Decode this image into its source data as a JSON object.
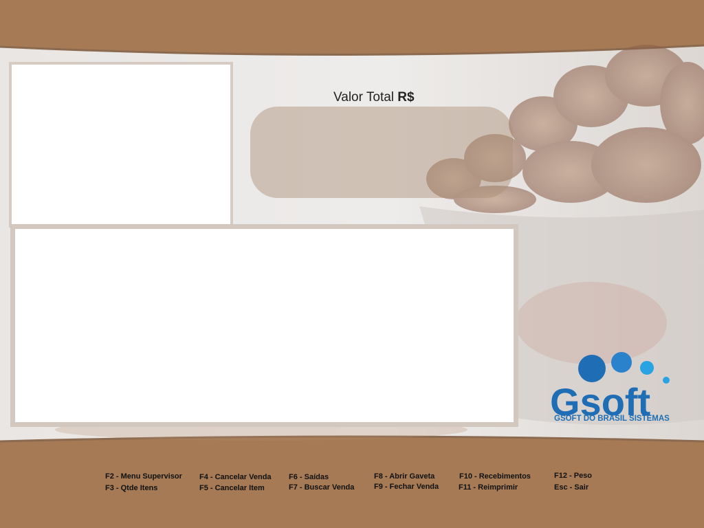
{
  "total": {
    "label_prefix": "Valor Total",
    "label_currency": "R$",
    "value": ""
  },
  "logo": {
    "wordmark": "Gsoft",
    "brand_name": "GSOFT DO BRASIL SISTEMAS"
  },
  "shortcuts": [
    {
      "key": "F2 - Menu Supervisor"
    },
    {
      "key": "F3 - Qtde Itens"
    },
    {
      "key": "F4 - Cancelar Venda"
    },
    {
      "key": "F5 - Cancelar Item"
    },
    {
      "key": "F6 - Saídas"
    },
    {
      "key": "F7 - Buscar Venda"
    },
    {
      "key": "F8 - Abrir Gaveta"
    },
    {
      "key": "F9 - Fechar Venda"
    },
    {
      "key": "F10 - Recebimentos"
    },
    {
      "key": "F11 - Reimprimir"
    },
    {
      "key": "F12 - Peso"
    },
    {
      "key": "Esc - Sair"
    }
  ],
  "colors": {
    "band": "#a57a55",
    "panel_border": "#d3c8bf",
    "logo_blue": "#1d6fb6",
    "logo_light_blue": "#2aa3e3"
  }
}
